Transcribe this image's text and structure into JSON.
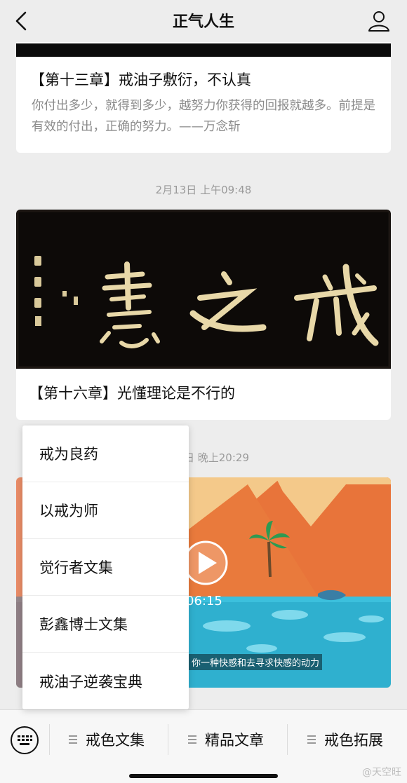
{
  "header": {
    "title": "正气人生"
  },
  "articles": [
    {
      "title": "【第十三章】戒油子敷衍，不认真",
      "desc": "你付出多少，就得到多少，越努力你获得的回报就越多。前提是有效的付出，正确的努力。——万念斩"
    },
    {
      "title": "【第十六章】光懂理论是不行的"
    }
  ],
  "timestamps": {
    "first": "2月13日 上午09:48",
    "second": "日 晚上20:29"
  },
  "video": {
    "duration": "06:15",
    "subtitle": "你一种快感和去寻求快感的动力"
  },
  "popup_menu": {
    "items": [
      "戒为良药",
      "以戒为师",
      "觉行者文集",
      "彭鑫博士文集",
      "戒油子逆袭宝典"
    ]
  },
  "bottom_menu": {
    "tabs": [
      "戒色文集",
      "精品文章",
      "戒色拓展"
    ]
  },
  "watermark": "@天空旺",
  "colors": {
    "background": "#ededed",
    "card": "#ffffff",
    "banner": "#0d0a08",
    "calligraphy": "#e8d8a8",
    "sky": "#f4c98a",
    "mountain": "#e8743a",
    "water": "#2fb0cf"
  }
}
